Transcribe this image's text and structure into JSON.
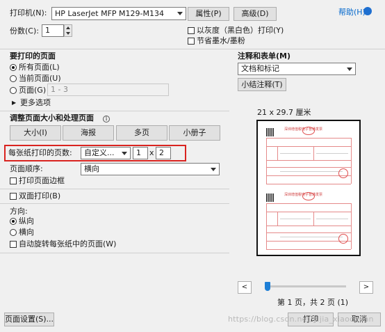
{
  "printer": {
    "label": "打印机(N):",
    "name": "HP LaserJet MFP M129-M134",
    "properties_button": "属性(P)",
    "advanced_button": "高级(D)",
    "help_link": "帮助(H)"
  },
  "copies": {
    "label": "份数(C):",
    "value": "1"
  },
  "options": {
    "grayscale": "以灰度（黑白色）打印(Y)",
    "save_ink": "节省墨水/墨粉"
  },
  "pages_to_print": {
    "title": "要打印的页面",
    "all": "所有页面(L)",
    "current": "当前页面(U)",
    "pages": "页面(G)",
    "pages_placeholder": "1 - 3",
    "more": "更多选项"
  },
  "comments": {
    "title": "注释和表单(M)",
    "selected": "文档和标记",
    "summarize_button": "小结注释(T)"
  },
  "page_sizing": {
    "title": "调整页面大小和处理页面",
    "buttons": [
      "大小(I)",
      "海报",
      "多页",
      "小册子"
    ],
    "pages_per_sheet_label": "每张纸打印的页数:",
    "pages_per_sheet_value": "自定义...",
    "cols": "1",
    "times": "x",
    "rows": "2",
    "page_order_label": "页面顺序:",
    "page_order_value": "横向",
    "print_border": "打印页面边框"
  },
  "duplex": {
    "label": "双面打印(B)"
  },
  "orientation": {
    "title": "方向:",
    "portrait": "纵向",
    "landscape": "横向",
    "auto_rotate": "自动旋转每张纸中的页面(W)"
  },
  "preview": {
    "paper_size": "21 x 29.7 厘米",
    "page_status": "第 1 页，共 2 页 (1)",
    "invoice_title": "深圳增值税电子普通发票",
    "slider_fraction": 0
  },
  "footer": {
    "page_setup": "页面设置(S)...",
    "print": "打印",
    "cancel": "取消",
    "watermark": "https://blog.csdn.net/yljia_xiaochuan"
  },
  "colors": {
    "highlight": "#d9231f",
    "link": "#0066cc",
    "slider": "#1e7fd6"
  }
}
